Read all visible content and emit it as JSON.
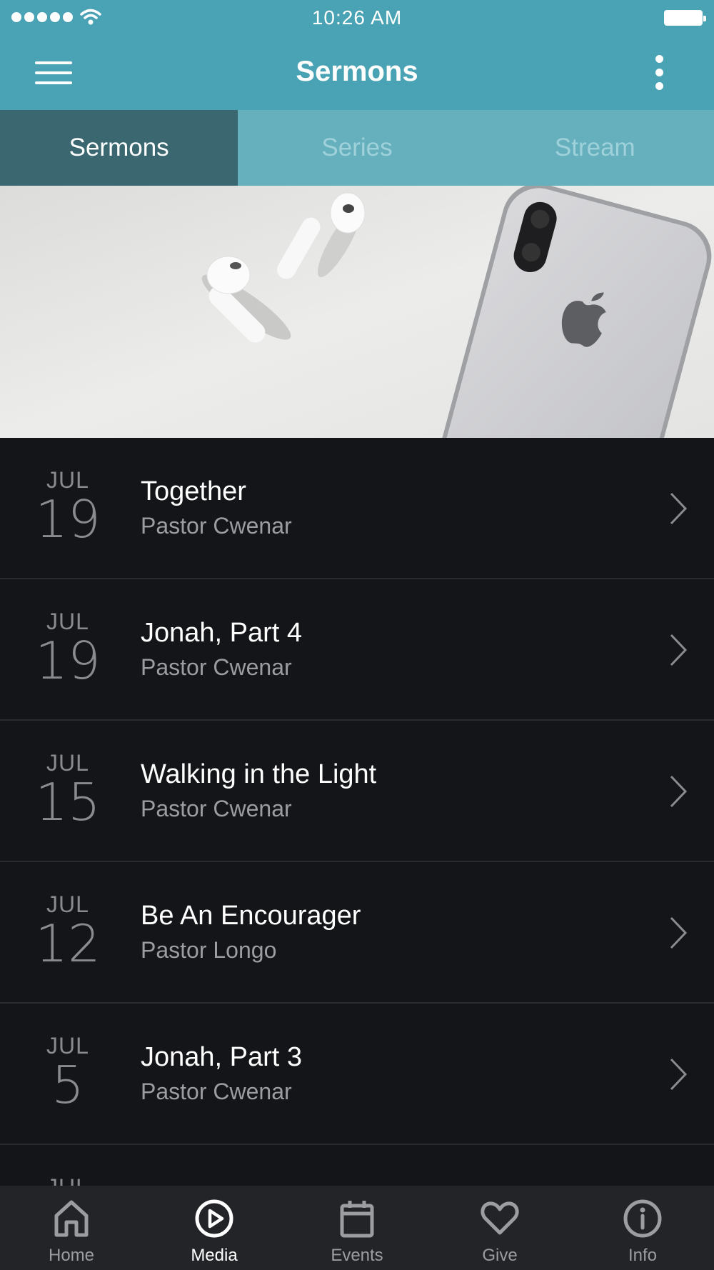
{
  "status_bar": {
    "time": "10:26 AM"
  },
  "header": {
    "title": "Sermons"
  },
  "tabs": [
    {
      "label": "Sermons",
      "active": true
    },
    {
      "label": "Series",
      "active": false
    },
    {
      "label": "Stream",
      "active": false
    }
  ],
  "sermons": [
    {
      "month": "JUL",
      "day": "19",
      "title": "Together",
      "speaker": "Pastor Cwenar"
    },
    {
      "month": "JUL",
      "day": "19",
      "title": "Jonah, Part 4",
      "speaker": "Pastor Cwenar"
    },
    {
      "month": "JUL",
      "day": "15",
      "title": "Walking in the Light",
      "speaker": "Pastor Cwenar"
    },
    {
      "month": "JUL",
      "day": "12",
      "title": "Be An Encourager",
      "speaker": "Pastor Longo"
    },
    {
      "month": "JUL",
      "day": "5",
      "title": "Jonah, Part 3",
      "speaker": "Pastor Cwenar"
    },
    {
      "month": "JUL",
      "day": "",
      "title": "",
      "speaker": ""
    }
  ],
  "bottom_nav": [
    {
      "label": "Home",
      "icon": "home-icon",
      "active": false
    },
    {
      "label": "Media",
      "icon": "play-circle-icon",
      "active": true
    },
    {
      "label": "Events",
      "icon": "calendar-icon",
      "active": false
    },
    {
      "label": "Give",
      "icon": "heart-icon",
      "active": false
    },
    {
      "label": "Info",
      "icon": "info-icon",
      "active": false
    }
  ],
  "colors": {
    "header": "#4aa3b4",
    "tab_active": "#3b6771",
    "tab_bar": "#66b0be",
    "list_bg": "#141518",
    "bottom_bar": "#232428"
  }
}
